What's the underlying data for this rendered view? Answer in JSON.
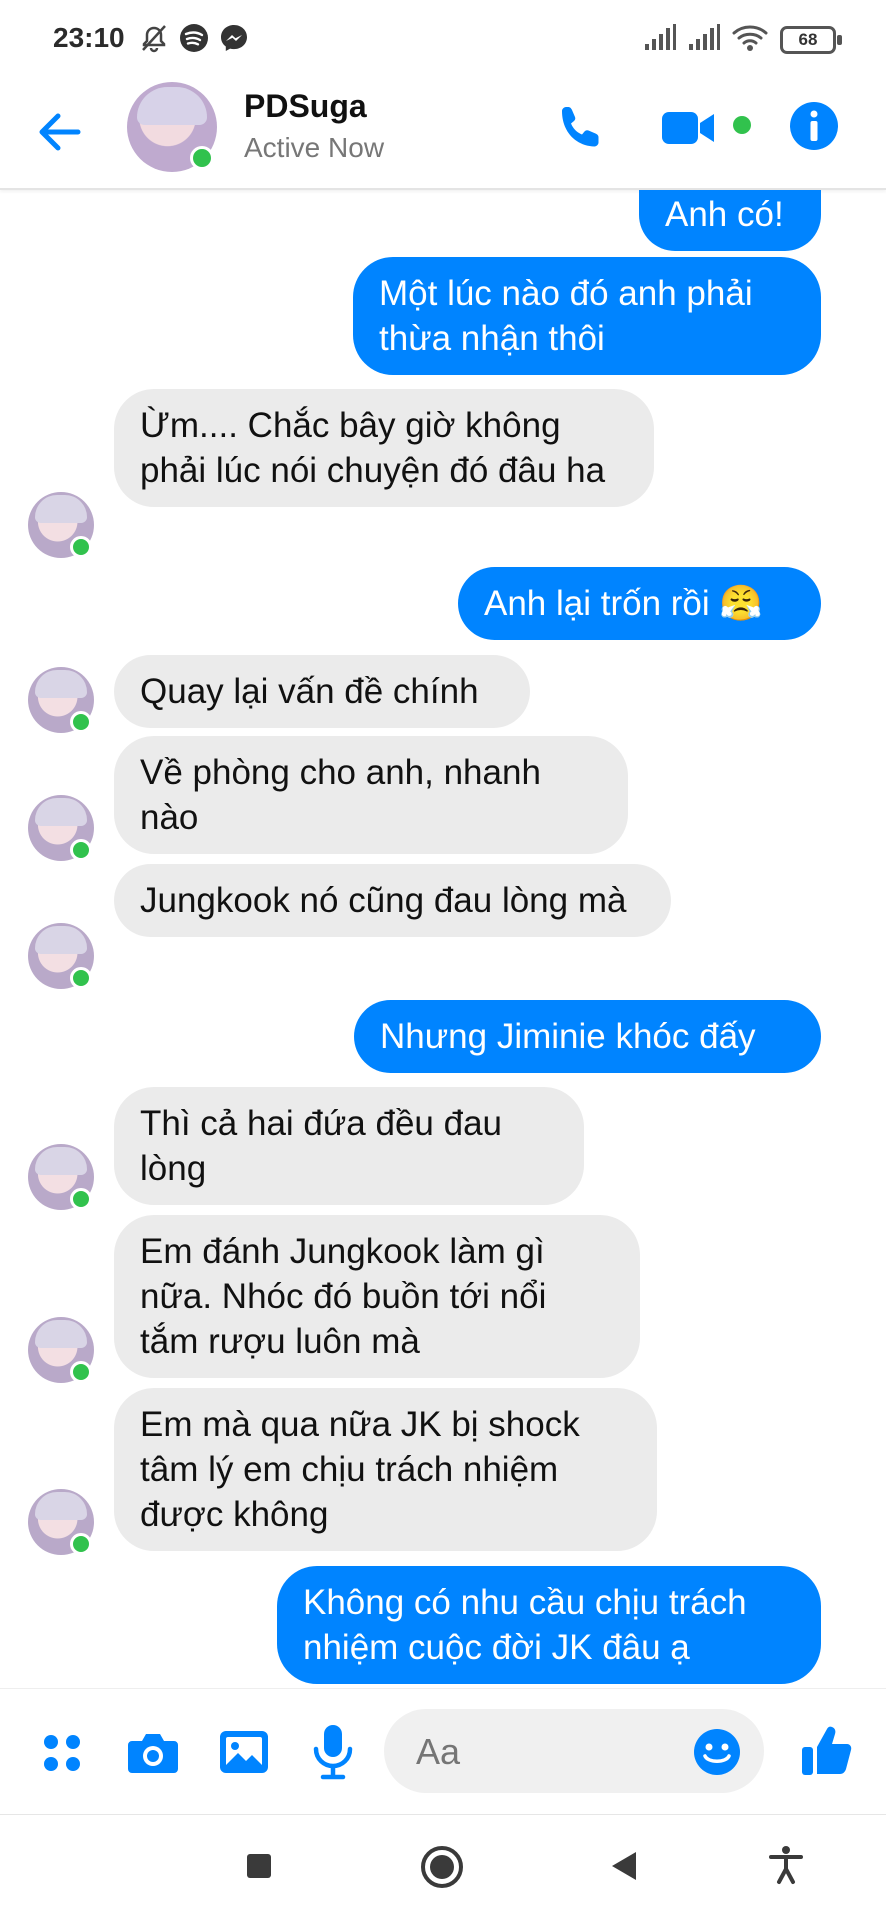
{
  "status": {
    "time": "23:10",
    "battery": "68",
    "icons": [
      "mute-icon",
      "spotify-icon",
      "messenger-icon",
      "signal-icon",
      "signal-icon",
      "wifi-icon",
      "battery-icon"
    ]
  },
  "header": {
    "name": "PDSuga",
    "status": "Active Now",
    "icons": [
      "back-arrow-icon",
      "phone-icon",
      "video-camera-icon",
      "info-icon"
    ],
    "accent": "#0084ff",
    "online_color": "#31c24d"
  },
  "messages": [
    {
      "side": "out",
      "text": "Anh có!"
    },
    {
      "side": "out",
      "text": "Một lúc nào đó anh phải thừa nhận thôi"
    },
    {
      "side": "in",
      "text": "Ừm.... Chắc bây giờ không phải lúc nói chuyện đó đâu ha"
    },
    {
      "side": "out",
      "text": "Anh lại trốn rồi 😤"
    },
    {
      "side": "in",
      "text": "Quay lại vấn đề chính"
    },
    {
      "side": "in",
      "text": "Về phòng cho anh, nhanh nào"
    },
    {
      "side": "in",
      "text": "Jungkook nó cũng đau lòng mà"
    },
    {
      "side": "out",
      "text": "Nhưng Jiminie khóc đấy"
    },
    {
      "side": "in",
      "text": "Thì cả hai đứa đều đau lòng"
    },
    {
      "side": "in",
      "text": "Em đánh Jungkook làm gì nữa. Nhóc đó buồn tới nổi tắm rượu luôn mà"
    },
    {
      "side": "in",
      "text": "Em mà qua nữa JK bị shock tâm lý em chịu trách nhiệm được không"
    },
    {
      "side": "out",
      "text": "Không có nhu cầu chịu trách nhiệm cuộc đời JK đâu ạ"
    }
  ],
  "composer": {
    "placeholder": "Aa",
    "icons": [
      "apps-grid-icon",
      "camera-icon",
      "gallery-icon",
      "microphone-icon",
      "emoji-icon",
      "thumbs-up-icon"
    ]
  },
  "navbar": {
    "icons": [
      "recents-square-icon",
      "home-circle-icon",
      "back-triangle-icon",
      "accessibility-icon"
    ]
  }
}
